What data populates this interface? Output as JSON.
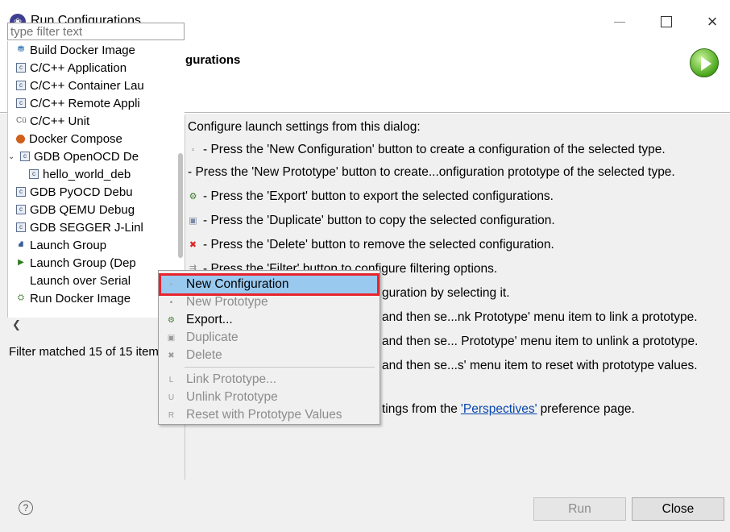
{
  "window": {
    "title": "Run Configurations",
    "app_icon": "eclipse-icon"
  },
  "header": {
    "title": "Create, manage, and run configurations"
  },
  "left": {
    "filter_placeholder": "type filter text",
    "tree": [
      {
        "label": "Build Docker Image",
        "icon": "docker-icon",
        "indent": 1
      },
      {
        "label": "C/C++ Application",
        "icon": "c-icon",
        "indent": 1
      },
      {
        "label": "C/C++ Container Lau",
        "icon": "c-icon",
        "indent": 1
      },
      {
        "label": "C/C++ Remote Appli",
        "icon": "c-icon",
        "indent": 1
      },
      {
        "label": "C/C++ Unit",
        "icon": "cu-icon",
        "indent": 1
      },
      {
        "label": "Docker Compose",
        "icon": "compose-icon",
        "indent": 1
      },
      {
        "label": "GDB OpenOCD De",
        "icon": "c-icon",
        "indent": 0,
        "expanded": true
      },
      {
        "label": "hello_world_deb",
        "icon": "c-icon",
        "indent": 2
      },
      {
        "label": "GDB PyOCD Debu",
        "icon": "c-icon",
        "indent": 1
      },
      {
        "label": "GDB QEMU Debug",
        "icon": "c-icon",
        "indent": 1
      },
      {
        "label": "GDB SEGGER J-Linl",
        "icon": "c-icon",
        "indent": 1
      },
      {
        "label": "Launch Group",
        "icon": "launch-group-icon",
        "indent": 1
      },
      {
        "label": "Launch Group (Dep",
        "icon": "play-icon",
        "indent": 1
      },
      {
        "label": "Launch over Serial",
        "icon": "",
        "indent": 1
      },
      {
        "label": "Run Docker Image",
        "icon": "docker-run-icon",
        "indent": 1
      }
    ],
    "filter_status": "Filter matched 15 of 15 item"
  },
  "right": {
    "intro": "Configure launch settings from this dialog:",
    "lines": [
      {
        "icon": "new-config-icon",
        "text": "- Press the 'New Configuration' button to create a configuration of the selected type."
      },
      {
        "icon": "",
        "text": "- Press the 'New Prototype' button to create...onfiguration prototype of the selected type."
      },
      {
        "icon": "export-icon",
        "text": "- Press the 'Export' button to export the selected configurations."
      },
      {
        "icon": "duplicate-icon",
        "text": "- Press the 'Duplicate' button to copy the selected configuration."
      },
      {
        "icon": "delete-icon",
        "text": "- Press the 'Delete' button to remove the selected configuration."
      },
      {
        "icon": "filter-icon",
        "text": "- Press the 'Filter' button to configure filtering options."
      },
      {
        "icon": "",
        "text": "guration by selecting it."
      },
      {
        "icon": "",
        "text": "and then se...nk Prototype' menu item to link a prototype."
      },
      {
        "icon": "",
        "text": "and then se... Prototype' menu item to unlink a prototype."
      },
      {
        "icon": "",
        "text": "and then se...s' menu item to reset with prototype values."
      }
    ],
    "perspectives_prefix": "tings from the ",
    "perspectives_link": "'Perspectives'",
    "perspectives_suffix": " preference page."
  },
  "context_menu": {
    "items": [
      {
        "label": "New Configuration",
        "icon": "new-config-icon",
        "enabled": true,
        "selected": true
      },
      {
        "label": "New Prototype",
        "icon": "new-prototype-icon",
        "enabled": false
      },
      {
        "label": "Export...",
        "icon": "export-icon",
        "enabled": true
      },
      {
        "label": "Duplicate",
        "icon": "duplicate-icon",
        "enabled": false
      },
      {
        "label": "Delete",
        "icon": "delete-icon",
        "enabled": false
      },
      {
        "label": "Link Prototype...",
        "icon": "link-prototype-icon",
        "enabled": false
      },
      {
        "label": "Unlink Prototype",
        "icon": "unlink-prototype-icon",
        "enabled": false
      },
      {
        "label": "Reset with Prototype Values",
        "icon": "reset-prototype-icon",
        "enabled": false
      }
    ]
  },
  "footer": {
    "run_label": "Run",
    "close_label": "Close"
  },
  "colors": {
    "selection": "#99c9ef",
    "highlight_border": "#e8232d",
    "link": "#0645ad"
  }
}
